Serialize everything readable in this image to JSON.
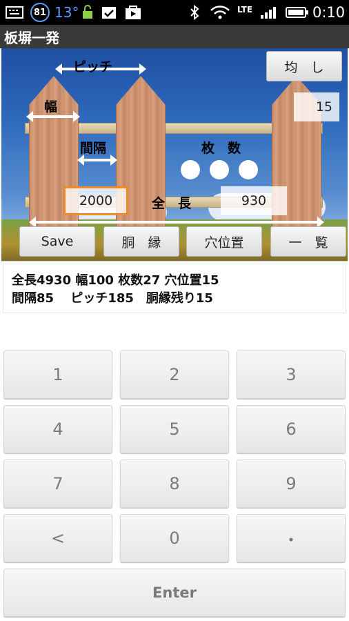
{
  "status_bar": {
    "badge": "81",
    "temperature": "13°",
    "network": "LTE",
    "time": "0:10"
  },
  "app_title": "板塀一発",
  "scene": {
    "pitch_label": "ピッチ",
    "width_label": "幅",
    "gap_label": "間隔",
    "count_label": "枚　数",
    "total_length_label": "全　長",
    "hole_value": "15",
    "input_value": "2000",
    "total_length_value": "930",
    "even_button": "均　し",
    "count_dots": 3
  },
  "buttons": {
    "save": "Save",
    "edge": "胴　縁",
    "hole": "穴位置",
    "list": "一　覧"
  },
  "info": {
    "line1": "全長4930 幅100 枚数27 穴位置15",
    "line2": "間隔85　 ピッチ185　胴縁残り15"
  },
  "keypad": {
    "keys": [
      "1",
      "2",
      "3",
      "4",
      "5",
      "6",
      "7",
      "8",
      "9",
      "<",
      "0",
      "・"
    ],
    "enter": "Enter"
  },
  "colors": {
    "status_bar": "#000000",
    "app_bar": "#3a3a3a",
    "sky": "#2f6bbd",
    "plank": "#d09670",
    "input_border": "#f08a24"
  }
}
